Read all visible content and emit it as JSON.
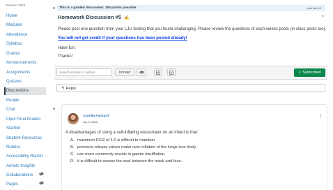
{
  "sidebar": {
    "term": "Summer 2023",
    "items": [
      {
        "label": "Home"
      },
      {
        "label": "Modules"
      },
      {
        "label": "Attendance"
      },
      {
        "label": "Syllabus"
      },
      {
        "label": "Grades"
      },
      {
        "label": "Announcements"
      },
      {
        "label": "Assignments"
      },
      {
        "label": "Quizzes"
      },
      {
        "label": "Discussions",
        "active": true
      },
      {
        "label": "People"
      },
      {
        "label": "Chat"
      },
      {
        "label": "Input Final Grades"
      },
      {
        "label": "Starfish"
      },
      {
        "label": "Student Resources"
      },
      {
        "label": "Rubrics"
      },
      {
        "label": "Accessibility Report"
      },
      {
        "label": "Annoto Insights"
      },
      {
        "label": "Collaborations",
        "icon": "eye-off-icon"
      },
      {
        "label": "Pages",
        "icon": "eye-off-icon"
      }
    ]
  },
  "banner": {
    "graded": "This is a graded discussion: 100 points possible",
    "due": "due Jun 12"
  },
  "topic": {
    "title": "Homework Discussion #5",
    "count": "97",
    "body": "Please post one question from your LJU testing that you found challanging. Please review the questions of each weeks posts (in class posts too).",
    "warning": "You will not get credit if your questions has been posted already!",
    "havefun": "Have fun.",
    "thanks": "Thanks!"
  },
  "toolbar": {
    "search_placeholder": "Search entries or author",
    "unread": "Unread",
    "subscribed": "Subscribed"
  },
  "reply": {
    "label": "Reply"
  },
  "entry": {
    "author": "Camilla Packard",
    "date": "Jun 3, 2023",
    "question": "A disadvantages of using a self-inflating resuscitator on an infant is that:",
    "options": [
      {
        "letter": "A.",
        "text": "maximum FIO2 of 1.0 is difficult to maintain."
      },
      {
        "letter": "B.",
        "text": "pressure-release valves make over-inflation of the lungs less likely."
      },
      {
        "letter": "C.",
        "text": "use more commonly results in gastric insufflation."
      },
      {
        "letter": "D.",
        "text": "it is difficult to assess the seal between the mask and face."
      }
    ]
  },
  "colors": {
    "accent": "#2b7abc",
    "success": "#0b874b",
    "link": "#0b3ee8"
  }
}
